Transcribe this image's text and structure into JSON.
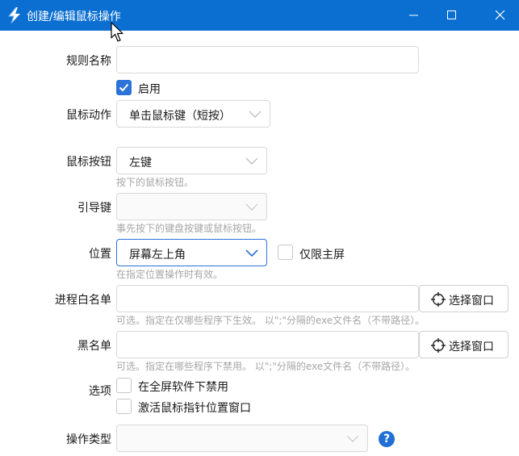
{
  "window": {
    "title": "创建/编辑鼠标操作"
  },
  "icons": {
    "app": "lightning-app-icon",
    "minimize": "minimize-icon",
    "maximize": "maximize-icon",
    "close": "close-icon",
    "cursor": "mouse-cursor-icon",
    "crosshair": "crosshair-icon",
    "help": "help-icon",
    "chevron": "chevron-down-icon"
  },
  "colors": {
    "titlebar": "#0b6fd1",
    "accent": "#2b73d9",
    "hint": "#a6a6a6"
  },
  "form": {
    "rule_name": {
      "label": "规则名称",
      "value": ""
    },
    "enabled": {
      "label": "启用",
      "checked": true
    },
    "mouse_action": {
      "label": "鼠标动作",
      "value": "单击鼠标键（短按）"
    },
    "mouse_button": {
      "label": "鼠标按钮",
      "value": "左键",
      "hint": "按下的鼠标按钮。"
    },
    "lead_key": {
      "label": "引导键",
      "value": "",
      "hint": "事先按下的键盘按键或鼠标按钮。"
    },
    "position": {
      "label": "位置",
      "value": "屏幕左上角",
      "hint": "在指定位置操作时有效。",
      "primary_only_label": "仅限主屏",
      "primary_only_checked": false
    },
    "whitelist": {
      "label": "进程白名单",
      "value": "",
      "button": "选择窗口",
      "hint": "可选。指定在仅哪些程序下生效。 以\";\"分隔的exe文件名（不带路径）。"
    },
    "blacklist": {
      "label": "黑名单",
      "value": "",
      "button": "选择窗口",
      "hint": "可选。指定在哪些程序下禁用。 以\";\"分隔的exe文件名（不带路径）。"
    },
    "options": {
      "label": "选项",
      "items": [
        {
          "label": "在全屏软件下禁用",
          "checked": false
        },
        {
          "label": "激活鼠标指针位置窗口",
          "checked": false
        }
      ]
    },
    "operation_type": {
      "label": "操作类型",
      "value": "",
      "help": "?"
    }
  }
}
